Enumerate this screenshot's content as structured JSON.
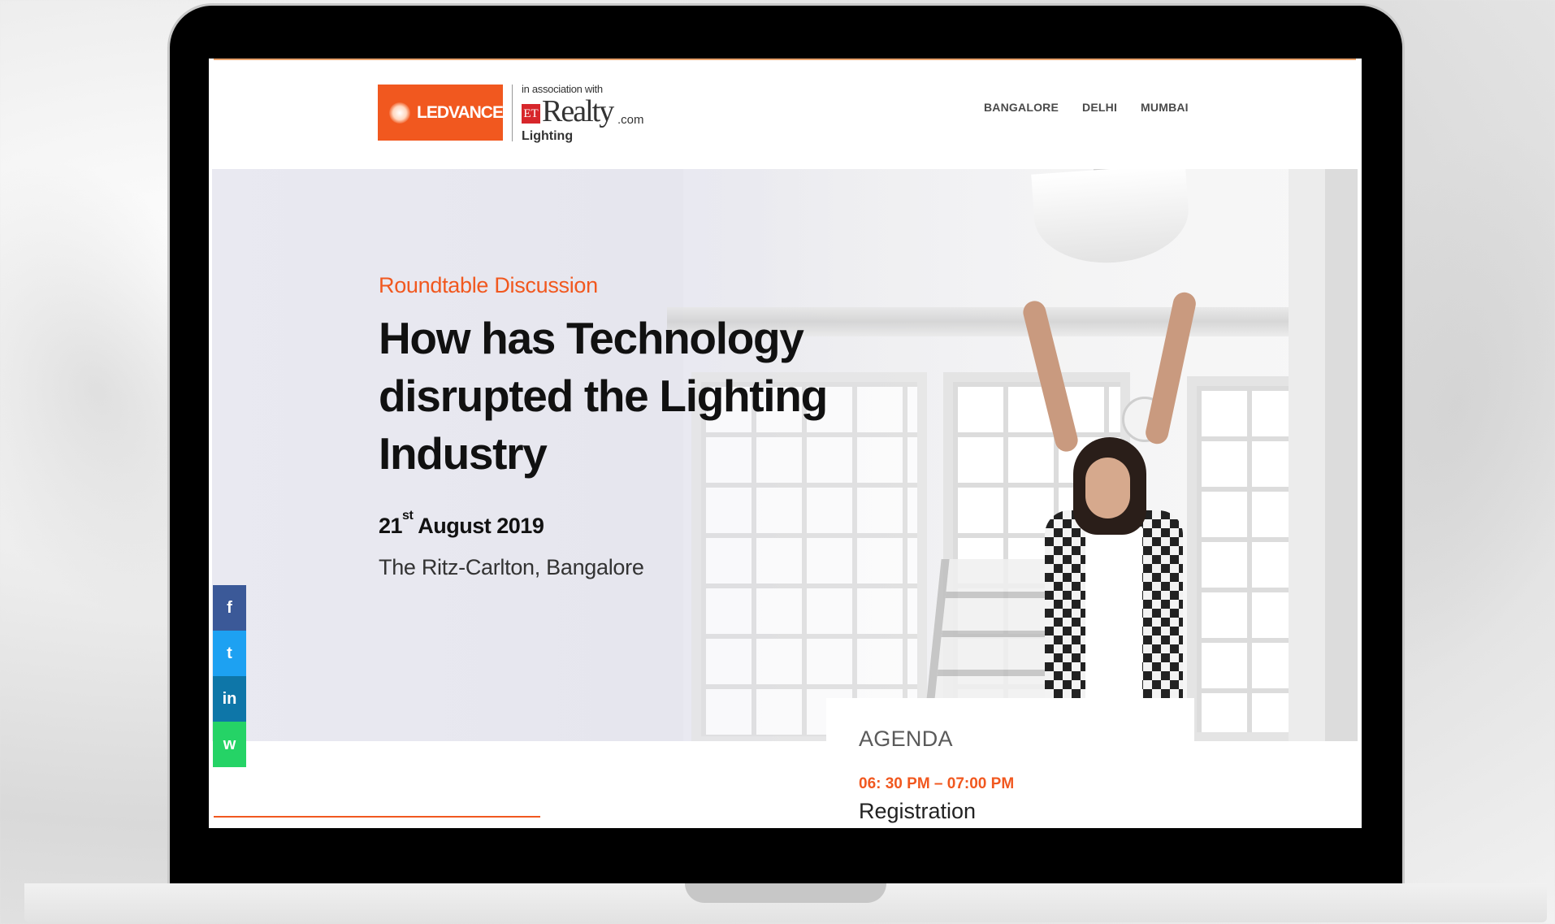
{
  "header": {
    "brand": "LEDVANCE",
    "association": "in association with",
    "partner_badge": "ET",
    "partner_name": "Realty",
    "partner_suffix": ".com",
    "partner_sub": "Lighting",
    "nav": [
      "BANGALORE",
      "DELHI",
      "MUMBAI"
    ]
  },
  "hero": {
    "kicker": "Roundtable Discussion",
    "title": "How has Technology disrupted the Lighting Industry",
    "date_day": "21",
    "date_suffix": "st",
    "date_rest": " August 2019",
    "venue": "The Ritz-Carlton, Bangalore"
  },
  "social": [
    "f",
    "t",
    "in",
    "w"
  ],
  "icons": [
    "facebook-icon",
    "twitter-icon",
    "linkedin-icon",
    "whatsapp-icon"
  ],
  "agenda": {
    "title": "AGENDA",
    "time": "06: 30 PM – 07:00 PM",
    "item": "Registration"
  },
  "colors": {
    "accent": "#f1581f",
    "facebook": "#3b5998",
    "twitter": "#1da1f2",
    "linkedin": "#0e76a8",
    "whatsapp": "#25d366"
  }
}
